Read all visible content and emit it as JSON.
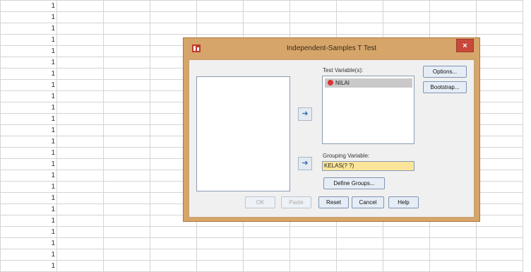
{
  "spreadsheet": {
    "row_values": [
      "1",
      "1",
      "1",
      "1",
      "1",
      "1",
      "1",
      "1",
      "1",
      "1",
      "1",
      "1",
      "1",
      "1",
      "1",
      "1",
      "1",
      "1",
      "1",
      "1",
      "1",
      "1",
      "1",
      "1"
    ]
  },
  "dialog": {
    "title": "Independent-Samples T Test",
    "close_glyph": "×",
    "test_variables_label": "Test Variable(s):",
    "test_variables": [
      "NILAI"
    ],
    "grouping_variable_label": "Grouping Variable:",
    "grouping_variable_value": "KELAS(? ?)",
    "buttons": {
      "options": "Options...",
      "bootstrap": "Bootstrap...",
      "define_groups": "Define Groups...",
      "ok": "OK",
      "paste": "Paste",
      "reset": "Reset",
      "cancel": "Cancel",
      "help": "Help"
    },
    "arrow_glyph": "➜"
  },
  "colors": {
    "dialog_frame": "#d6a56a",
    "grouping_field": "#fbe59a",
    "close_button": "#c8493c"
  }
}
